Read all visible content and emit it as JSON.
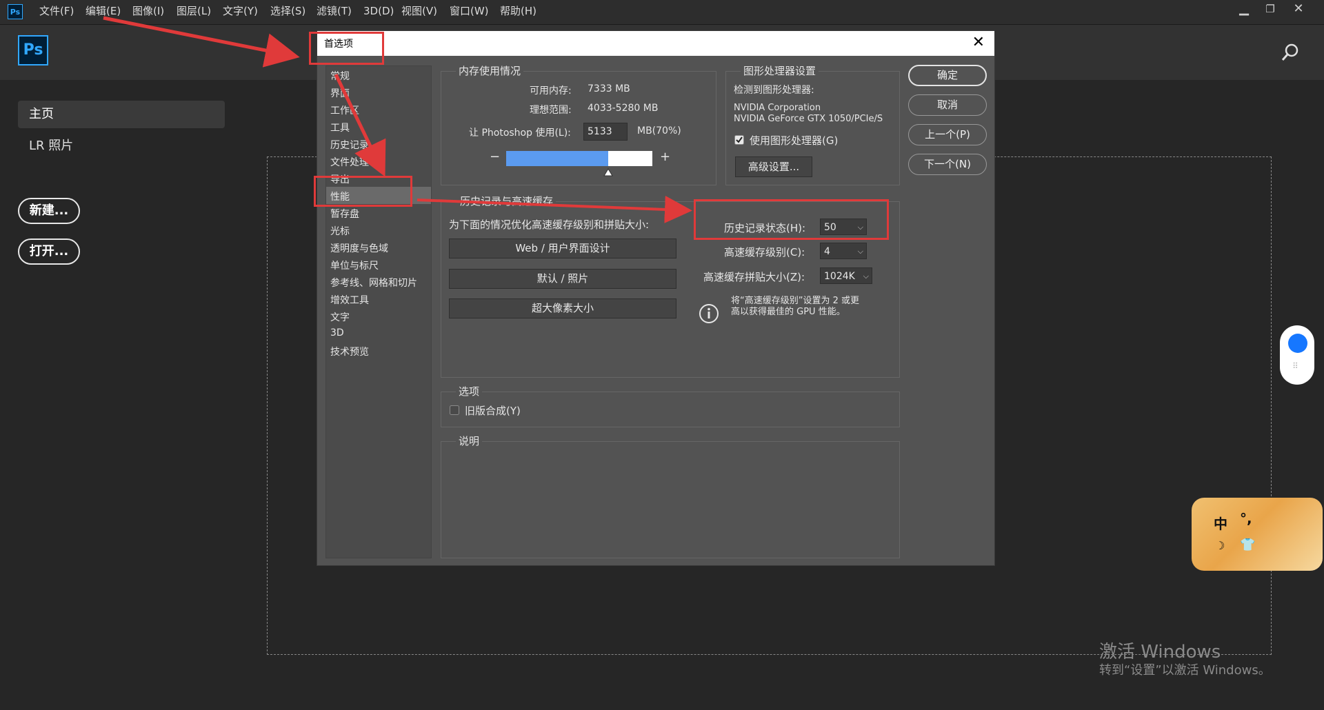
{
  "menubar": {
    "app_icon": "Ps",
    "items": [
      "文件(F)",
      "编辑(E)",
      "图像(I)",
      "图层(L)",
      "文字(Y)",
      "选择(S)",
      "滤镜(T)",
      "3D(D)",
      "视图(V)",
      "窗口(W)",
      "帮助(H)"
    ],
    "window_controls": [
      "minimize-icon",
      "restore-icon",
      "close-icon"
    ]
  },
  "header": {
    "logo": "Ps"
  },
  "sidebar": {
    "home": "主页",
    "lr": "LR 照片",
    "new_btn": "新建...",
    "open_btn": "打开..."
  },
  "dialog": {
    "title": "首选项",
    "categories": [
      "常规",
      "界面",
      "工作区",
      "工具",
      "历史记录",
      "文件处理",
      "导出",
      "性能",
      "暂存盘",
      "光标",
      "透明度与色域",
      "单位与标尺",
      "参考线、网格和切片",
      "增效工具",
      "文字",
      "3D",
      "技术预览"
    ],
    "active_category": "性能",
    "memory": {
      "title": "内存使用情况",
      "available_label": "可用内存:",
      "available_value": "7333 MB",
      "ideal_label": "理想范围:",
      "ideal_value": "4033-5280 MB",
      "let_label": "让 Photoshop 使用(L):",
      "let_value": "5133",
      "percent_label": "MB(70%)",
      "usage_fraction": 0.7,
      "minus": "−",
      "plus": "+"
    },
    "gpu": {
      "title": "图形处理器设置",
      "detected_label": "检测到图形处理器:",
      "vendor": "NVIDIA Corporation",
      "model": "NVIDIA GeForce GTX 1050/PCIe/S",
      "use_gpu_label": "使用图形处理器(G)",
      "use_gpu_checked": true,
      "advanced_btn": "高级设置..."
    },
    "history_cache": {
      "title": "历史记录与高速缓存",
      "optimize_label": "为下面的情况优化高速缓存级别和拼贴大小:",
      "preset_buttons": [
        "Web / 用户界面设计",
        "默认 / 照片",
        "超大像素大小"
      ],
      "history_states_label": "历史记录状态(H):",
      "history_states_value": "50",
      "cache_levels_label": "高速缓存级别(C):",
      "cache_levels_value": "4",
      "cache_tile_label": "高速缓存拼贴大小(Z):",
      "cache_tile_value": "1024K",
      "tip_line1": "将“高速缓存级别”设置为 2 或更",
      "tip_line2": "高以获得最佳的 GPU 性能。"
    },
    "options": {
      "title": "选项",
      "legacy_label": "旧版合成(Y)",
      "legacy_checked": false
    },
    "description": {
      "title": "说明"
    },
    "buttons": {
      "ok": "确定",
      "cancel": "取消",
      "prev": "上一个(P)",
      "next": "下一个(N)"
    }
  },
  "watermark": {
    "line1": "激活 Windows",
    "line2": "转到“设置”以激活 Windows。"
  },
  "ime": {
    "cells": [
      "中",
      "°,",
      "☽",
      "👕"
    ]
  },
  "colors": {
    "accent": "#31a8ff",
    "highlight": "#e03a3a",
    "bar": "#5b9bf0"
  }
}
